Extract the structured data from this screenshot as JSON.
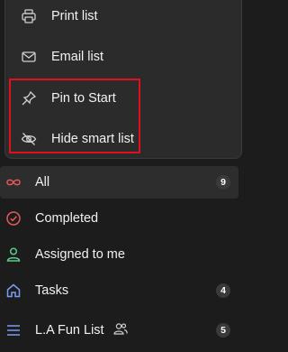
{
  "context_menu": {
    "items": [
      {
        "label": "Print list",
        "icon": "printer-icon"
      },
      {
        "label": "Email list",
        "icon": "mail-icon"
      },
      {
        "label": "Pin to Start",
        "icon": "pin-icon"
      },
      {
        "label": "Hide smart list",
        "icon": "eye-off-icon"
      }
    ],
    "highlight_color": "#e0101e"
  },
  "lists": {
    "items": [
      {
        "label": "All",
        "count": "9",
        "icon": "infinity-icon",
        "icon_color": "#e05a5a",
        "selected": true
      },
      {
        "label": "Completed",
        "count": "",
        "icon": "check-circle-icon",
        "icon_color": "#e05a5a"
      },
      {
        "label": "Assigned to me",
        "count": "",
        "icon": "person-icon",
        "icon_color": "#5cc98a"
      },
      {
        "label": "Tasks",
        "count": "4",
        "icon": "home-icon",
        "icon_color": "#7b9cf2"
      },
      {
        "label": "L.A Fun List",
        "count": "5",
        "icon": "list-icon",
        "icon_color": "#7b9cf2",
        "shared": true
      }
    ]
  }
}
